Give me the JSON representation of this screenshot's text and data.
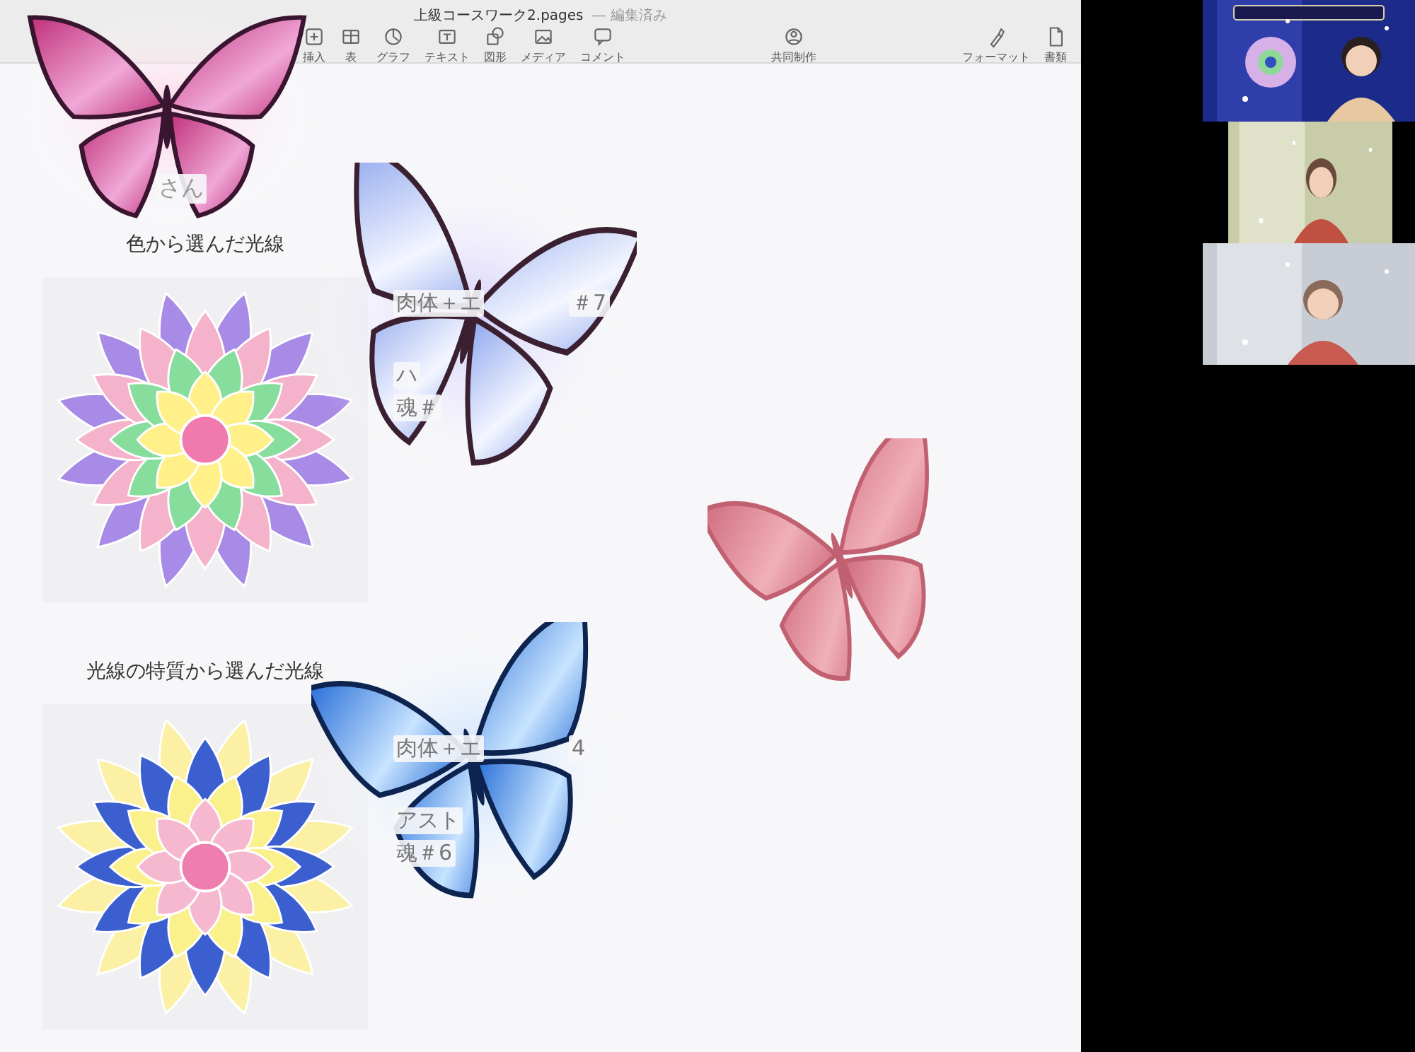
{
  "window": {
    "title": "上級コースワーク2.pages",
    "status": "— 編集済み"
  },
  "toolbar": {
    "left": [
      {
        "label": "挿入",
        "kind": "insert"
      },
      {
        "label": "表",
        "kind": "table"
      },
      {
        "label": "グラフ",
        "kind": "chart"
      },
      {
        "label": "テキスト",
        "kind": "text"
      },
      {
        "label": "図形",
        "kind": "shape"
      },
      {
        "label": "メディア",
        "kind": "media"
      },
      {
        "label": "コメント",
        "kind": "comment"
      }
    ],
    "center": [
      {
        "label": "共同制作",
        "kind": "collab"
      }
    ],
    "right": [
      {
        "label": "フォーマット",
        "kind": "format"
      },
      {
        "label": "書類",
        "kind": "document"
      }
    ]
  },
  "document": {
    "fragment": "さん",
    "sections": [
      {
        "heading": "色から選んだ光線",
        "color": "#a88be6",
        "notes": [
          [
            "肉体＋エ",
            "＃7"
          ],
          [
            "ハ"
          ],
          [
            "魂＃"
          ]
        ]
      },
      {
        "heading": "光線の特質から選んだ光線",
        "color": "#3b5fcf",
        "notes": [
          [
            "肉体＋エ",
            "4"
          ],
          [
            "アスト"
          ],
          [
            "魂＃6"
          ]
        ]
      }
    ]
  }
}
